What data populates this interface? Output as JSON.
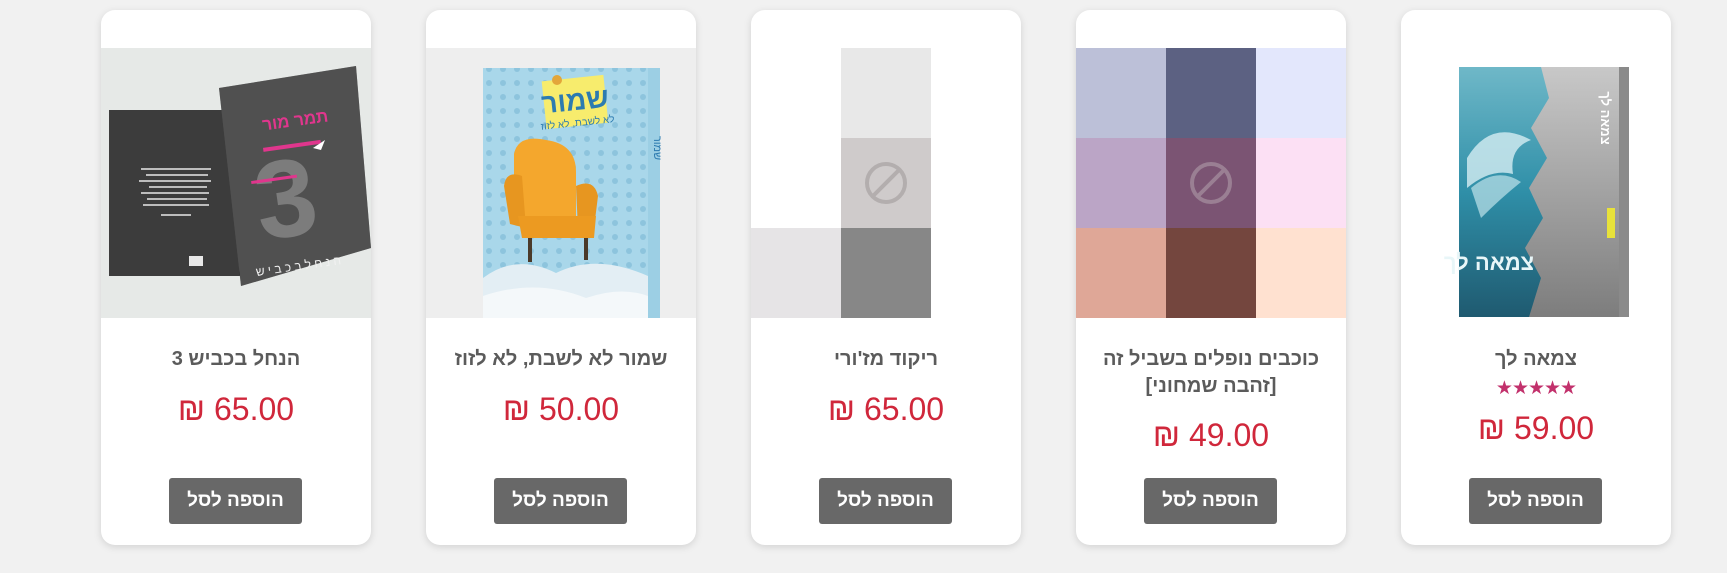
{
  "products": [
    {
      "title": "הנחל בכביש 3",
      "price": "65.00 ₪",
      "button": "הוספה לסל",
      "cover_text": {
        "author": "תמר מור",
        "title_vertical": "ה נ ח ל ב כ ב י ש",
        "number": "3"
      }
    },
    {
      "title": "שמור לא לשבת, לא לזוז",
      "price": "50.00 ₪",
      "button": "הוספה לסל",
      "cover_text": {
        "title": "שמור",
        "subtitle": "לא לשבת, לא לזוז",
        "spine": "שמור",
        "note": "שמור לא"
      }
    },
    {
      "title": "ריקוד מז'ורי",
      "price": "65.00 ₪",
      "button": "הוספה לסל",
      "placeholder_colors": [
        "#ffffff",
        "#e8e8e8",
        "#ffffff",
        "#ffffff",
        "#cfcbcb",
        "#ffffff",
        "#e6e4e6",
        "#878787",
        "#ffffff"
      ]
    },
    {
      "title": "כוכבים נופלים בשביל זה [זהבה שמחוני]",
      "price": "49.00 ₪",
      "button": "הוספה לסל",
      "placeholder_colors": [
        "#bcc0d8",
        "#5c6182",
        "#e3e7fc",
        "#bba5c6",
        "#7b5473",
        "#fce0f4",
        "#dfa797",
        "#74463e",
        "#ffe1d0"
      ]
    },
    {
      "title": "צמאה לך",
      "price": "59.00 ₪",
      "button": "הוספה לסל",
      "rating": 5,
      "stars": "★★★★★",
      "cover_text": {
        "title": "צמאה לך",
        "spine": "צמאה לך"
      }
    }
  ],
  "colors": {
    "price": "#d0273b",
    "star": "#c2316c",
    "button_bg": "#686868",
    "title": "#5b5b5b",
    "background": "#f1f1f1"
  }
}
